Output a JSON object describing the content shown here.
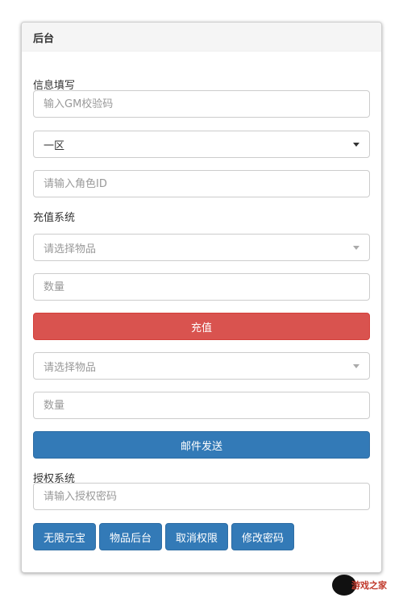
{
  "panel": {
    "title": "后台"
  },
  "info": {
    "label": "信息填写",
    "gm_placeholder": "输入GM校验码",
    "zone_selected": "一区",
    "role_placeholder": "请输入角色ID"
  },
  "recharge": {
    "label": "充值系统",
    "item_placeholder": "请选择物品",
    "qty_placeholder": "数量",
    "button_label": "充值"
  },
  "mail": {
    "item_placeholder": "请选择物品",
    "qty_placeholder": "数量",
    "button_label": "邮件发送"
  },
  "auth": {
    "label": "授权系统",
    "password_placeholder": "请输入授权密码",
    "buttons": [
      "无限元宝",
      "物品后台",
      "取消权限",
      "修改密码"
    ]
  },
  "watermark": {
    "text": "游戏之家"
  },
  "colors": {
    "danger": "#d9534f",
    "primary": "#337ab7"
  }
}
